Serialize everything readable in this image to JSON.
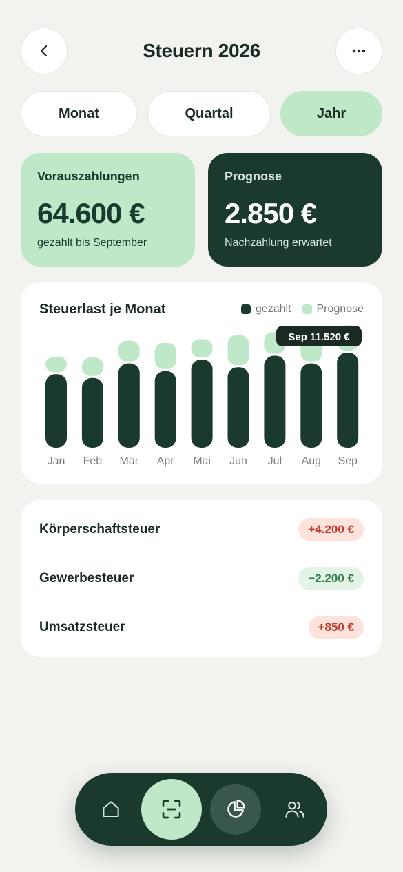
{
  "header": {
    "title": "Steuern 2026",
    "back_icon": "chevron-left-icon",
    "more_icon": "more-horizontal-icon"
  },
  "period_tabs": [
    {
      "label": "Monat",
      "active": false
    },
    {
      "label": "Quartal",
      "active": false
    },
    {
      "label": "Jahr",
      "active": true
    }
  ],
  "summary": {
    "prepayments": {
      "title": "Vorauszahlungen",
      "value": "64.600 €",
      "subtitle": "gezahlt bis September",
      "color": "#bfe8c8"
    },
    "forecast": {
      "title": "Prognose",
      "value": "2.850 €",
      "subtitle": "Nachzahlung erwartet",
      "color": "#1b3a2e"
    }
  },
  "chart": {
    "title": "Steuerlast je Monat",
    "legend": [
      {
        "label": "gezahlt",
        "color": "#1b3a2e"
      },
      {
        "label": "Prognose",
        "color": "#bfe8c8"
      }
    ],
    "tooltip": "Sep 11.520 €"
  },
  "chart_data": {
    "type": "bar",
    "title": "Steuerlast je Monat",
    "categories": [
      "Jan",
      "Feb",
      "Mär",
      "Apr",
      "Mai",
      "Jun",
      "Jul",
      "Aug",
      "Sep"
    ],
    "series": [
      {
        "name": "gezahlt",
        "values": [
          96,
          91,
          110,
          100,
          115,
          105,
          120,
          110,
          124
        ]
      },
      {
        "name": "Prognose",
        "values": [
          20,
          24,
          27,
          34,
          24,
          39,
          28,
          38,
          33
        ]
      }
    ],
    "stacked": true,
    "colors": {
      "gezahlt": "#1b3a2e",
      "Prognose": "#bfe8c8"
    },
    "ylim": [
      0,
      160
    ],
    "grid": false,
    "legend_position": "top-right",
    "highlight": {
      "category": "Sep",
      "label": "Sep 11.520 €"
    }
  },
  "breakdown": [
    {
      "label": "Körperschaftsteuer",
      "value": "+4.200 €",
      "trend": "up",
      "bg": "#fde3dc",
      "fg": "#c0392b"
    },
    {
      "label": "Gewerbesteuer",
      "value": "−2.200 €",
      "trend": "down",
      "bg": "#e3f4e6",
      "fg": "#2e7d4a"
    },
    {
      "label": "Umsatzsteuer",
      "value": "+850 €",
      "trend": "up",
      "bg": "#fde3dc",
      "fg": "#c0392b"
    }
  ],
  "nav": {
    "items": [
      {
        "icon": "home-icon",
        "active": false
      },
      {
        "icon": "scan-icon",
        "active": false
      },
      {
        "icon": "pie-chart-icon",
        "active": true
      },
      {
        "icon": "users-icon",
        "active": false
      }
    ]
  }
}
